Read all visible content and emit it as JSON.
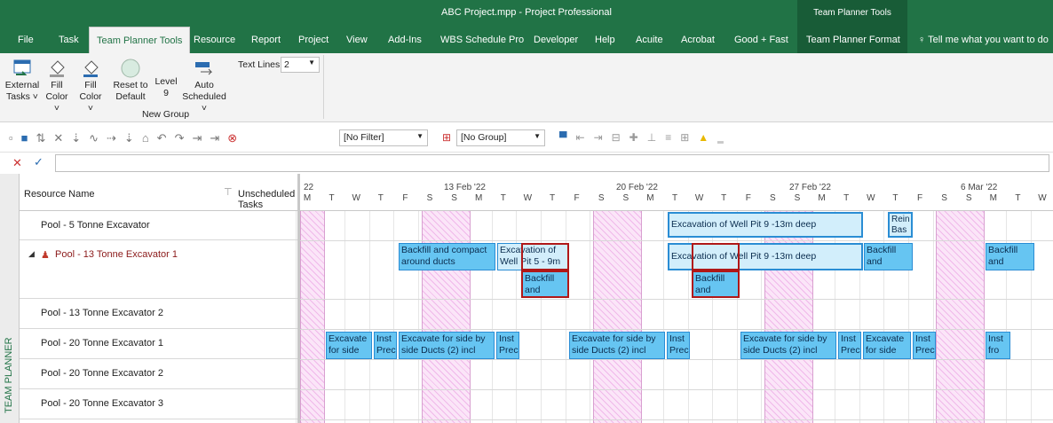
{
  "window": {
    "title": "ABC Project.mpp  -  Project Professional",
    "context_title": "Team Planner Tools"
  },
  "menu": {
    "tabs": [
      "File",
      "Task",
      "Team Planner Tools",
      "Resource",
      "Report",
      "Project",
      "View",
      "Add-Ins",
      "WBS Schedule Pro",
      "Developer",
      "Help",
      "Acuite",
      "Acrobat",
      "Good + Fast",
      "Team Planner Format"
    ],
    "active": "Team Planner Tools",
    "tell_me": "Tell me what you want to do"
  },
  "ribbon": {
    "external": [
      "External",
      "Tasks ˅"
    ],
    "fill1": [
      "Fill",
      "Color ˅"
    ],
    "fill2": [
      "Fill",
      "Color ˅"
    ],
    "reset": [
      "Reset to",
      "Default"
    ],
    "level": [
      "Level",
      "9"
    ],
    "auto": [
      "Auto",
      "Scheduled ˅"
    ],
    "text_lines_label": "Text Lines:",
    "text_lines_value": "2",
    "group": "New Group"
  },
  "toolbar": {
    "filter": "[No Filter]",
    "group": "[No Group]"
  },
  "grid": {
    "col_resource": "Resource Name",
    "col_unscheduled": "Unscheduled Tasks",
    "side_label": "TEAM PLANNER"
  },
  "timeline": {
    "dates": [
      "22",
      "13 Feb '22",
      "20 Feb '22",
      "27 Feb '22",
      "6 Mar '22"
    ],
    "days": [
      "M",
      "T",
      "W",
      "T",
      "F",
      "S",
      "S",
      "M",
      "T",
      "W",
      "T",
      "F",
      "S",
      "S",
      "M",
      "T",
      "W",
      "T",
      "F",
      "S",
      "S",
      "M",
      "T",
      "W",
      "T",
      "F",
      "S",
      "S",
      "M",
      "T",
      "W"
    ]
  },
  "resources": [
    "Pool - 5 Tonne Excavator",
    "Pool - 13 Tonne Excavator 1",
    "Pool - 13 Tonne Excavator 2",
    "Pool - 20 Tonne Excavator 1",
    "Pool - 20 Tonne Excavator 2",
    "Pool - 20 Tonne Excavator 3"
  ],
  "tasks": {
    "r1a": [
      "Excavation of Well Pit 9 -13m deep"
    ],
    "r1b": [
      "Rein",
      "Bas"
    ],
    "r2a": [
      "Backfill and compact",
      "around ducts"
    ],
    "r2b": [
      "Excavation of",
      "Well Pit 5 - 9m"
    ],
    "r2c": [
      "Backfill",
      "and"
    ],
    "r2d": [
      "Excavation of Well Pit 9 -13m deep"
    ],
    "r2e": [
      "Backfill",
      "and"
    ],
    "r2f": [
      "Backfill",
      "and"
    ],
    "r2g": [
      "Backfill",
      "and"
    ],
    "r4a": [
      "Excavate",
      "for side"
    ],
    "r4b": [
      "Inst",
      "Prec"
    ],
    "r4c": [
      "Excavate for side by",
      "side Ducts (2) incl"
    ],
    "r4d": [
      "Inst",
      "Prec"
    ],
    "r4e": [
      "Excavate for side by",
      "side Ducts (2) incl"
    ],
    "r4f": [
      "Inst",
      "Prec"
    ],
    "r4g": [
      "Excavate for side by",
      "side Ducts (2) incl"
    ],
    "r4h": [
      "Inst",
      "Prec"
    ],
    "r4i": [
      "Excavate",
      "for side"
    ],
    "r4j": [
      "Inst",
      "Prec"
    ],
    "r4k": [
      "Inst",
      "fro"
    ]
  }
}
